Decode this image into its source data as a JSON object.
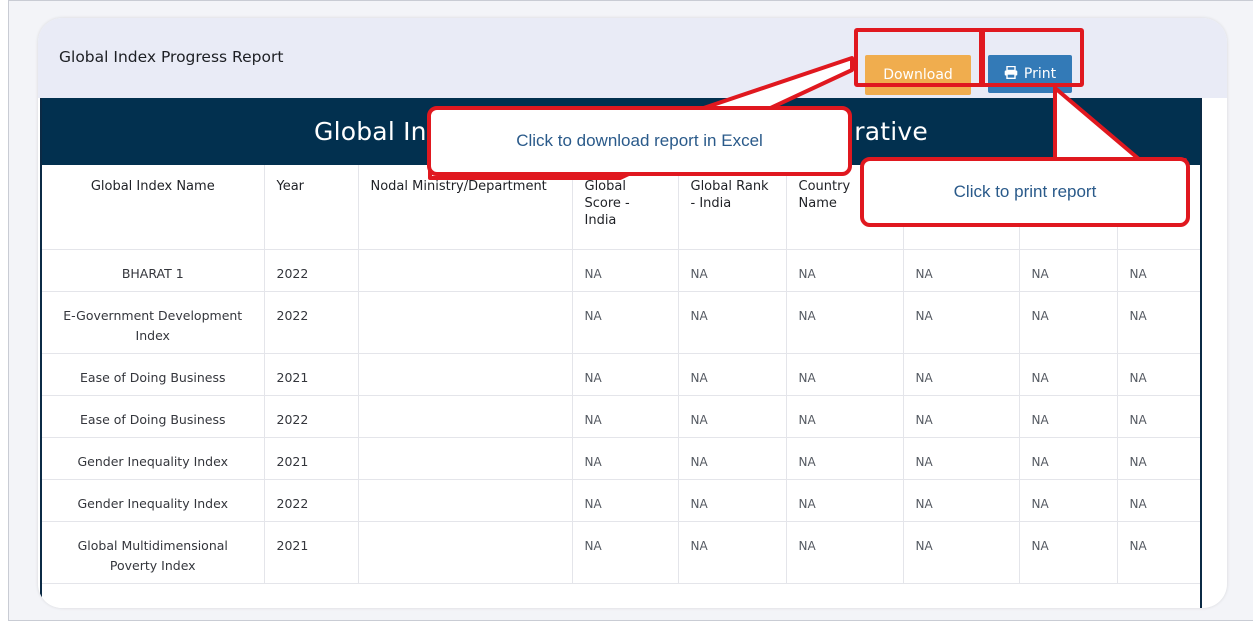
{
  "report": {
    "title": "Global Index Progress Report",
    "download_label": "Download",
    "print_label": "Print",
    "print_icon": "printer-icon",
    "banner_left": "Global In",
    "banner_right": "arative"
  },
  "table": {
    "headers": [
      "Global Index Name",
      "Year",
      "Nodal Ministry/Department",
      "Global Score - India",
      "Global Rank - India",
      "Country Name",
      "",
      "",
      ""
    ],
    "rows": [
      [
        "BHARAT 1",
        "2022",
        "",
        "NA",
        "NA",
        "NA",
        "NA",
        "NA",
        "NA"
      ],
      [
        "E-Government Development Index",
        "2022",
        "",
        "NA",
        "NA",
        "NA",
        "NA",
        "NA",
        "NA"
      ],
      [
        "Ease of Doing Business",
        "2021",
        "",
        "NA",
        "NA",
        "NA",
        "NA",
        "NA",
        "NA"
      ],
      [
        "Ease of Doing Business",
        "2022",
        "",
        "NA",
        "NA",
        "NA",
        "NA",
        "NA",
        "NA"
      ],
      [
        "Gender Inequality Index",
        "2021",
        "",
        "NA",
        "NA",
        "NA",
        "NA",
        "NA",
        "NA"
      ],
      [
        "Gender Inequality Index",
        "2022",
        "",
        "NA",
        "NA",
        "NA",
        "NA",
        "NA",
        "NA"
      ],
      [
        "Global Multidimensional Poverty Index",
        "2021",
        "",
        "NA",
        "NA",
        "NA",
        "NA",
        "NA",
        "NA"
      ]
    ]
  },
  "annotations": {
    "download_callout": "Click to download  report in Excel",
    "print_callout": "Click to print report",
    "highlight_color": "#e0181f"
  },
  "colors": {
    "banner": "#02304f",
    "download_button": "#f0ad4e",
    "print_button": "#337ab7"
  }
}
